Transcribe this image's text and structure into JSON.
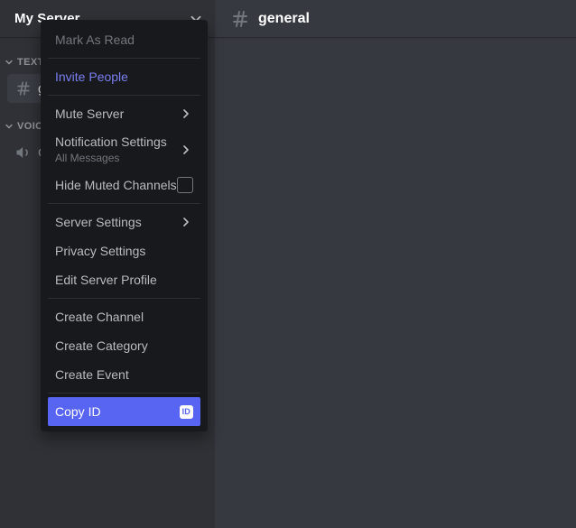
{
  "sidebar": {
    "server_name": "My Server",
    "header_icon": "chevron-down-icon",
    "categories": [
      {
        "label": "TEXT CHANNELS",
        "caret": "caret-down-icon"
      },
      {
        "label": "VOICE CHANNELS",
        "caret": "caret-down-icon"
      }
    ],
    "text_channel": {
      "icon": "hash-icon",
      "label": "general"
    },
    "voice_channel": {
      "icon": "speaker-icon",
      "label": "General"
    }
  },
  "main": {
    "channel_icon": "hash-icon",
    "channel_name": "general"
  },
  "context_menu": {
    "items": [
      {
        "label": "Mark As Read",
        "state": "disabled",
        "trailing": "none"
      },
      {
        "label": "Invite People",
        "state": "invite",
        "trailing": "none"
      },
      {
        "label": "Mute Server",
        "state": "normal",
        "trailing": "caret"
      },
      {
        "label": "Notification Settings",
        "sub": "All Messages",
        "state": "normal",
        "trailing": "caret"
      },
      {
        "label": "Hide Muted Channels",
        "state": "normal",
        "trailing": "checkbox"
      },
      {
        "label": "Server Settings",
        "state": "normal",
        "trailing": "caret"
      },
      {
        "label": "Privacy Settings",
        "state": "normal",
        "trailing": "none"
      },
      {
        "label": "Edit Server Profile",
        "state": "normal",
        "trailing": "none"
      },
      {
        "label": "Create Channel",
        "state": "normal",
        "trailing": "none"
      },
      {
        "label": "Create Category",
        "state": "normal",
        "trailing": "none"
      },
      {
        "label": "Create Event",
        "state": "normal",
        "trailing": "none"
      },
      {
        "label": "Copy ID",
        "state": "highlight",
        "trailing": "id-badge",
        "badge_text": "ID"
      }
    ],
    "separators_after": [
      0,
      1,
      4,
      7,
      10
    ]
  },
  "colors": {
    "menu_bg": "#18191c",
    "sidebar_bg": "#2f3136",
    "main_bg": "#36393f",
    "blurple": "#5865f2",
    "invite_text": "#7a7ef0",
    "text_normal": "#b9bbbe",
    "text_muted": "#72767d"
  }
}
